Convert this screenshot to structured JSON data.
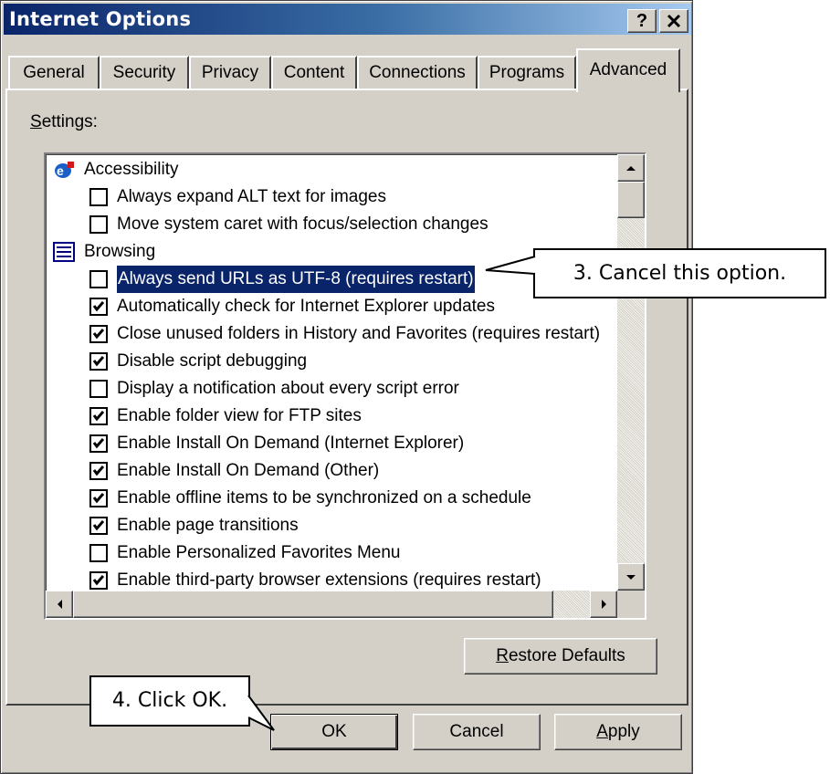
{
  "window": {
    "title": "Internet Options",
    "help_label": "?",
    "close_label": "×"
  },
  "tabs": [
    {
      "label": "General"
    },
    {
      "label": "Security"
    },
    {
      "label": "Privacy"
    },
    {
      "label": "Content"
    },
    {
      "label": "Connections"
    },
    {
      "label": "Programs"
    },
    {
      "label": "Advanced",
      "selected": true
    }
  ],
  "settings": {
    "label_prefix": "S",
    "label_rest": "ettings:",
    "items": [
      {
        "type": "category",
        "label": "Accessibility",
        "icon": "accessibility-icon"
      },
      {
        "type": "option",
        "label": "Always expand ALT text for images",
        "checked": false
      },
      {
        "type": "option",
        "label": "Move system caret with focus/selection changes",
        "checked": false
      },
      {
        "type": "category",
        "label": "Browsing",
        "icon": "browsing-icon"
      },
      {
        "type": "option",
        "label": "Always send URLs as UTF-8 (requires restart)",
        "checked": false,
        "selected": true
      },
      {
        "type": "option",
        "label": "Automatically check for Internet Explorer updates",
        "checked": true
      },
      {
        "type": "option",
        "label": "Close unused folders in History and Favorites (requires restart)",
        "checked": true
      },
      {
        "type": "option",
        "label": "Disable script debugging",
        "checked": true
      },
      {
        "type": "option",
        "label": "Display a notification about every script error",
        "checked": false
      },
      {
        "type": "option",
        "label": "Enable folder view for FTP sites",
        "checked": true
      },
      {
        "type": "option",
        "label": "Enable Install On Demand (Internet Explorer)",
        "checked": true
      },
      {
        "type": "option",
        "label": "Enable Install On Demand (Other)",
        "checked": true
      },
      {
        "type": "option",
        "label": "Enable offline items to be synchronized on a schedule",
        "checked": true
      },
      {
        "type": "option",
        "label": "Enable page transitions",
        "checked": true
      },
      {
        "type": "option",
        "label": "Enable Personalized Favorites Menu",
        "checked": false
      },
      {
        "type": "option",
        "label": "Enable third-party browser extensions (requires restart)",
        "checked": true
      }
    ]
  },
  "buttons": {
    "restore_prefix": "R",
    "restore_rest": "estore Defaults",
    "ok": "OK",
    "cancel": "Cancel",
    "apply_prefix": "A",
    "apply_rest": "pply"
  },
  "callouts": {
    "step3": "3. Cancel this option.",
    "step4": "4. Click OK."
  },
  "colors": {
    "title_bar": "#0a246a",
    "selection": "#0a246a",
    "face": "#d4d0c8"
  }
}
